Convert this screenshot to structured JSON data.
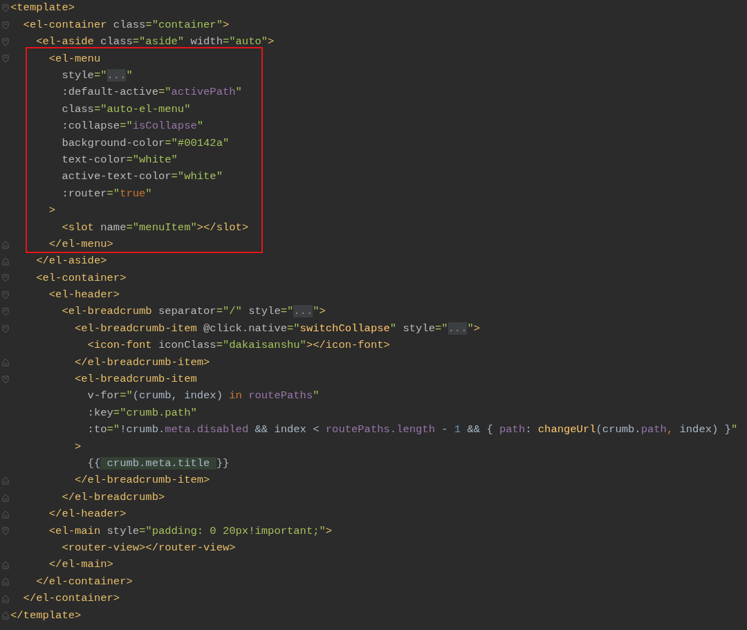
{
  "code": [
    {
      "highlighted": false,
      "lines": [
        {
          "kind": "fold_start",
          "tokens": [
            {
              "kind": "tag",
              "text": "<template>"
            }
          ]
        },
        {
          "kind": "fold_start",
          "tokens": [
            {
              "kind": "tag",
              "text": "  <el-container"
            },
            {
              "kind": "attr",
              "text": " class"
            },
            {
              "kind": "str",
              "text": "=\"container\""
            },
            {
              "kind": "tag",
              "text": ">"
            }
          ]
        },
        {
          "kind": "fold_start",
          "tokens": [
            {
              "kind": "tag",
              "text": "    <el-aside"
            },
            {
              "kind": "attr",
              "text": " class"
            },
            {
              "kind": "str",
              "text": "=\"aside\""
            },
            {
              "kind": "attr",
              "text": " width"
            },
            {
              "kind": "str",
              "text": "=\"auto\""
            },
            {
              "kind": "tag",
              "text": ">"
            }
          ]
        }
      ]
    },
    {
      "highlighted": true,
      "lines": [
        {
          "kind": "fold_start",
          "tokens": [
            {
              "kind": "tag",
              "text": "      <el-menu"
            }
          ]
        },
        {
          "kind": "line",
          "tokens": [
            {
              "kind": "attr",
              "text": "        style"
            },
            {
              "kind": "str",
              "text": "=\""
            },
            {
              "kind": "folded",
              "text": "..."
            },
            {
              "kind": "str",
              "text": "\""
            }
          ]
        },
        {
          "kind": "line",
          "tokens": [
            {
              "kind": "attr",
              "text": "        :default-active"
            },
            {
              "kind": "str",
              "text": "=\""
            },
            {
              "kind": "var",
              "text": "activePath"
            },
            {
              "kind": "str",
              "text": "\""
            }
          ]
        },
        {
          "kind": "line",
          "tokens": [
            {
              "kind": "attr",
              "text": "        class"
            },
            {
              "kind": "str",
              "text": "=\"auto-el-menu\""
            }
          ]
        },
        {
          "kind": "line",
          "tokens": [
            {
              "kind": "attr",
              "text": "        :collapse"
            },
            {
              "kind": "str",
              "text": "=\""
            },
            {
              "kind": "var",
              "text": "isCollapse"
            },
            {
              "kind": "str",
              "text": "\""
            }
          ]
        },
        {
          "kind": "line",
          "tokens": [
            {
              "kind": "attr",
              "text": "        background-color"
            },
            {
              "kind": "str",
              "text": "=\"#00142a\""
            }
          ]
        },
        {
          "kind": "line",
          "tokens": [
            {
              "kind": "attr",
              "text": "        text-color"
            },
            {
              "kind": "str",
              "text": "=\"white\""
            }
          ]
        },
        {
          "kind": "line",
          "tokens": [
            {
              "kind": "attr",
              "text": "        active-text-color"
            },
            {
              "kind": "str",
              "text": "=\"white\""
            }
          ]
        },
        {
          "kind": "line",
          "tokens": [
            {
              "kind": "attr",
              "text": "        :router"
            },
            {
              "kind": "str",
              "text": "=\""
            },
            {
              "kind": "keyword",
              "text": "true"
            },
            {
              "kind": "str",
              "text": "\""
            }
          ]
        },
        {
          "kind": "line",
          "tokens": [
            {
              "kind": "tag",
              "text": "      >"
            }
          ]
        },
        {
          "kind": "line",
          "tokens": [
            {
              "kind": "tag",
              "text": "        <slot"
            },
            {
              "kind": "attr",
              "text": " name"
            },
            {
              "kind": "str",
              "text": "=\"menuItem\""
            },
            {
              "kind": "tag",
              "text": "></slot>"
            }
          ]
        },
        {
          "kind": "fold_end",
          "tokens": [
            {
              "kind": "tag",
              "text": "      </el-menu>"
            }
          ]
        }
      ]
    },
    {
      "highlighted": false,
      "lines": [
        {
          "kind": "fold_end",
          "tokens": [
            {
              "kind": "tag",
              "text": "    </el-aside>"
            }
          ]
        },
        {
          "kind": "fold_start",
          "tokens": [
            {
              "kind": "tag",
              "text": "    <el-container>"
            }
          ]
        },
        {
          "kind": "fold_start",
          "tokens": [
            {
              "kind": "tag",
              "text": "      <el-header>"
            }
          ]
        },
        {
          "kind": "fold_start",
          "tokens": [
            {
              "kind": "tag",
              "text": "        <el-breadcrumb"
            },
            {
              "kind": "attr",
              "text": " separator"
            },
            {
              "kind": "str",
              "text": "=\"/\""
            },
            {
              "kind": "attr",
              "text": " style"
            },
            {
              "kind": "str",
              "text": "=\""
            },
            {
              "kind": "folded",
              "text": "..."
            },
            {
              "kind": "str",
              "text": "\""
            },
            {
              "kind": "tag",
              "text": ">"
            }
          ]
        },
        {
          "kind": "fold_start",
          "tokens": [
            {
              "kind": "tag",
              "text": "          <el-breadcrumb-item"
            },
            {
              "kind": "attr",
              "text": " @click.native"
            },
            {
              "kind": "str",
              "text": "=\""
            },
            {
              "kind": "func",
              "text": "switchCollapse"
            },
            {
              "kind": "str",
              "text": "\""
            },
            {
              "kind": "attr",
              "text": " style"
            },
            {
              "kind": "str",
              "text": "=\""
            },
            {
              "kind": "folded",
              "text": "..."
            },
            {
              "kind": "str",
              "text": "\""
            },
            {
              "kind": "tag",
              "text": ">"
            }
          ]
        },
        {
          "kind": "line",
          "tokens": [
            {
              "kind": "tag",
              "text": "            <icon-font"
            },
            {
              "kind": "attr",
              "text": " iconClass"
            },
            {
              "kind": "str",
              "text": "=\"dakaisanshu\""
            },
            {
              "kind": "tag",
              "text": "></icon-font>"
            }
          ]
        },
        {
          "kind": "fold_end",
          "tokens": [
            {
              "kind": "tag",
              "text": "          </el-breadcrumb-item>"
            }
          ]
        },
        {
          "kind": "fold_start",
          "tokens": [
            {
              "kind": "tag",
              "text": "          <el-breadcrumb-item"
            }
          ]
        },
        {
          "kind": "line",
          "tokens": [
            {
              "kind": "attr",
              "text": "            v-for"
            },
            {
              "kind": "str",
              "text": "=\""
            },
            {
              "kind": "plain",
              "text": "(crumb, index) "
            },
            {
              "kind": "keyword",
              "text": "in"
            },
            {
              "kind": "var",
              "text": " routePaths"
            },
            {
              "kind": "str",
              "text": "\""
            }
          ]
        },
        {
          "kind": "line",
          "tokens": [
            {
              "kind": "attr",
              "text": "            :key"
            },
            {
              "kind": "str",
              "text": "=\"crumb.path\""
            }
          ]
        },
        {
          "kind": "line",
          "tokens": [
            {
              "kind": "attr",
              "text": "            :to"
            },
            {
              "kind": "str",
              "text": "=\""
            },
            {
              "kind": "plain",
              "text": "!crumb."
            },
            {
              "kind": "var",
              "text": "meta.disabled"
            },
            {
              "kind": "plain",
              "text": " && index < "
            },
            {
              "kind": "var",
              "text": "routePaths.length"
            },
            {
              "kind": "plain",
              "text": " - "
            },
            {
              "kind": "num",
              "text": "1"
            },
            {
              "kind": "plain",
              "text": " && { "
            },
            {
              "kind": "var",
              "text": "path"
            },
            {
              "kind": "plain",
              "text": ": "
            },
            {
              "kind": "func",
              "text": "changeUrl"
            },
            {
              "kind": "plain",
              "text": "(crumb."
            },
            {
              "kind": "var",
              "text": "path"
            },
            {
              "kind": "keyword",
              "text": ","
            },
            {
              "kind": "plain",
              "text": " index) }"
            },
            {
              "kind": "str",
              "text": "\""
            }
          ]
        },
        {
          "kind": "line",
          "tokens": [
            {
              "kind": "tag",
              "text": "          >"
            }
          ]
        },
        {
          "kind": "line",
          "tokens": [
            {
              "kind": "plain",
              "text": "            {{"
            },
            {
              "kind": "interp",
              "text": " crumb.meta.title "
            },
            {
              "kind": "plain",
              "text": "}}"
            }
          ]
        },
        {
          "kind": "fold_end",
          "tokens": [
            {
              "kind": "tag",
              "text": "          </el-breadcrumb-item>"
            }
          ]
        },
        {
          "kind": "fold_end",
          "tokens": [
            {
              "kind": "tag",
              "text": "        </el-breadcrumb>"
            }
          ]
        },
        {
          "kind": "fold_end",
          "tokens": [
            {
              "kind": "tag",
              "text": "      </el-header>"
            }
          ]
        },
        {
          "kind": "fold_start",
          "tokens": [
            {
              "kind": "tag",
              "text": "      <el-main"
            },
            {
              "kind": "attr",
              "text": " style"
            },
            {
              "kind": "str",
              "text": "=\"padding: 0 20px!important;\""
            },
            {
              "kind": "tag",
              "text": ">"
            }
          ]
        },
        {
          "kind": "line",
          "tokens": [
            {
              "kind": "tag",
              "text": "        <router-view></router-view>"
            }
          ]
        },
        {
          "kind": "fold_end",
          "tokens": [
            {
              "kind": "tag",
              "text": "      </el-main>"
            }
          ]
        },
        {
          "kind": "fold_end",
          "tokens": [
            {
              "kind": "tag",
              "text": "    </el-container>"
            }
          ]
        },
        {
          "kind": "fold_end",
          "tokens": [
            {
              "kind": "tag",
              "text": "  </el-container>"
            }
          ]
        },
        {
          "kind": "fold_end",
          "tokens": [
            {
              "kind": "tag",
              "text": "</template>"
            }
          ]
        }
      ]
    }
  ]
}
